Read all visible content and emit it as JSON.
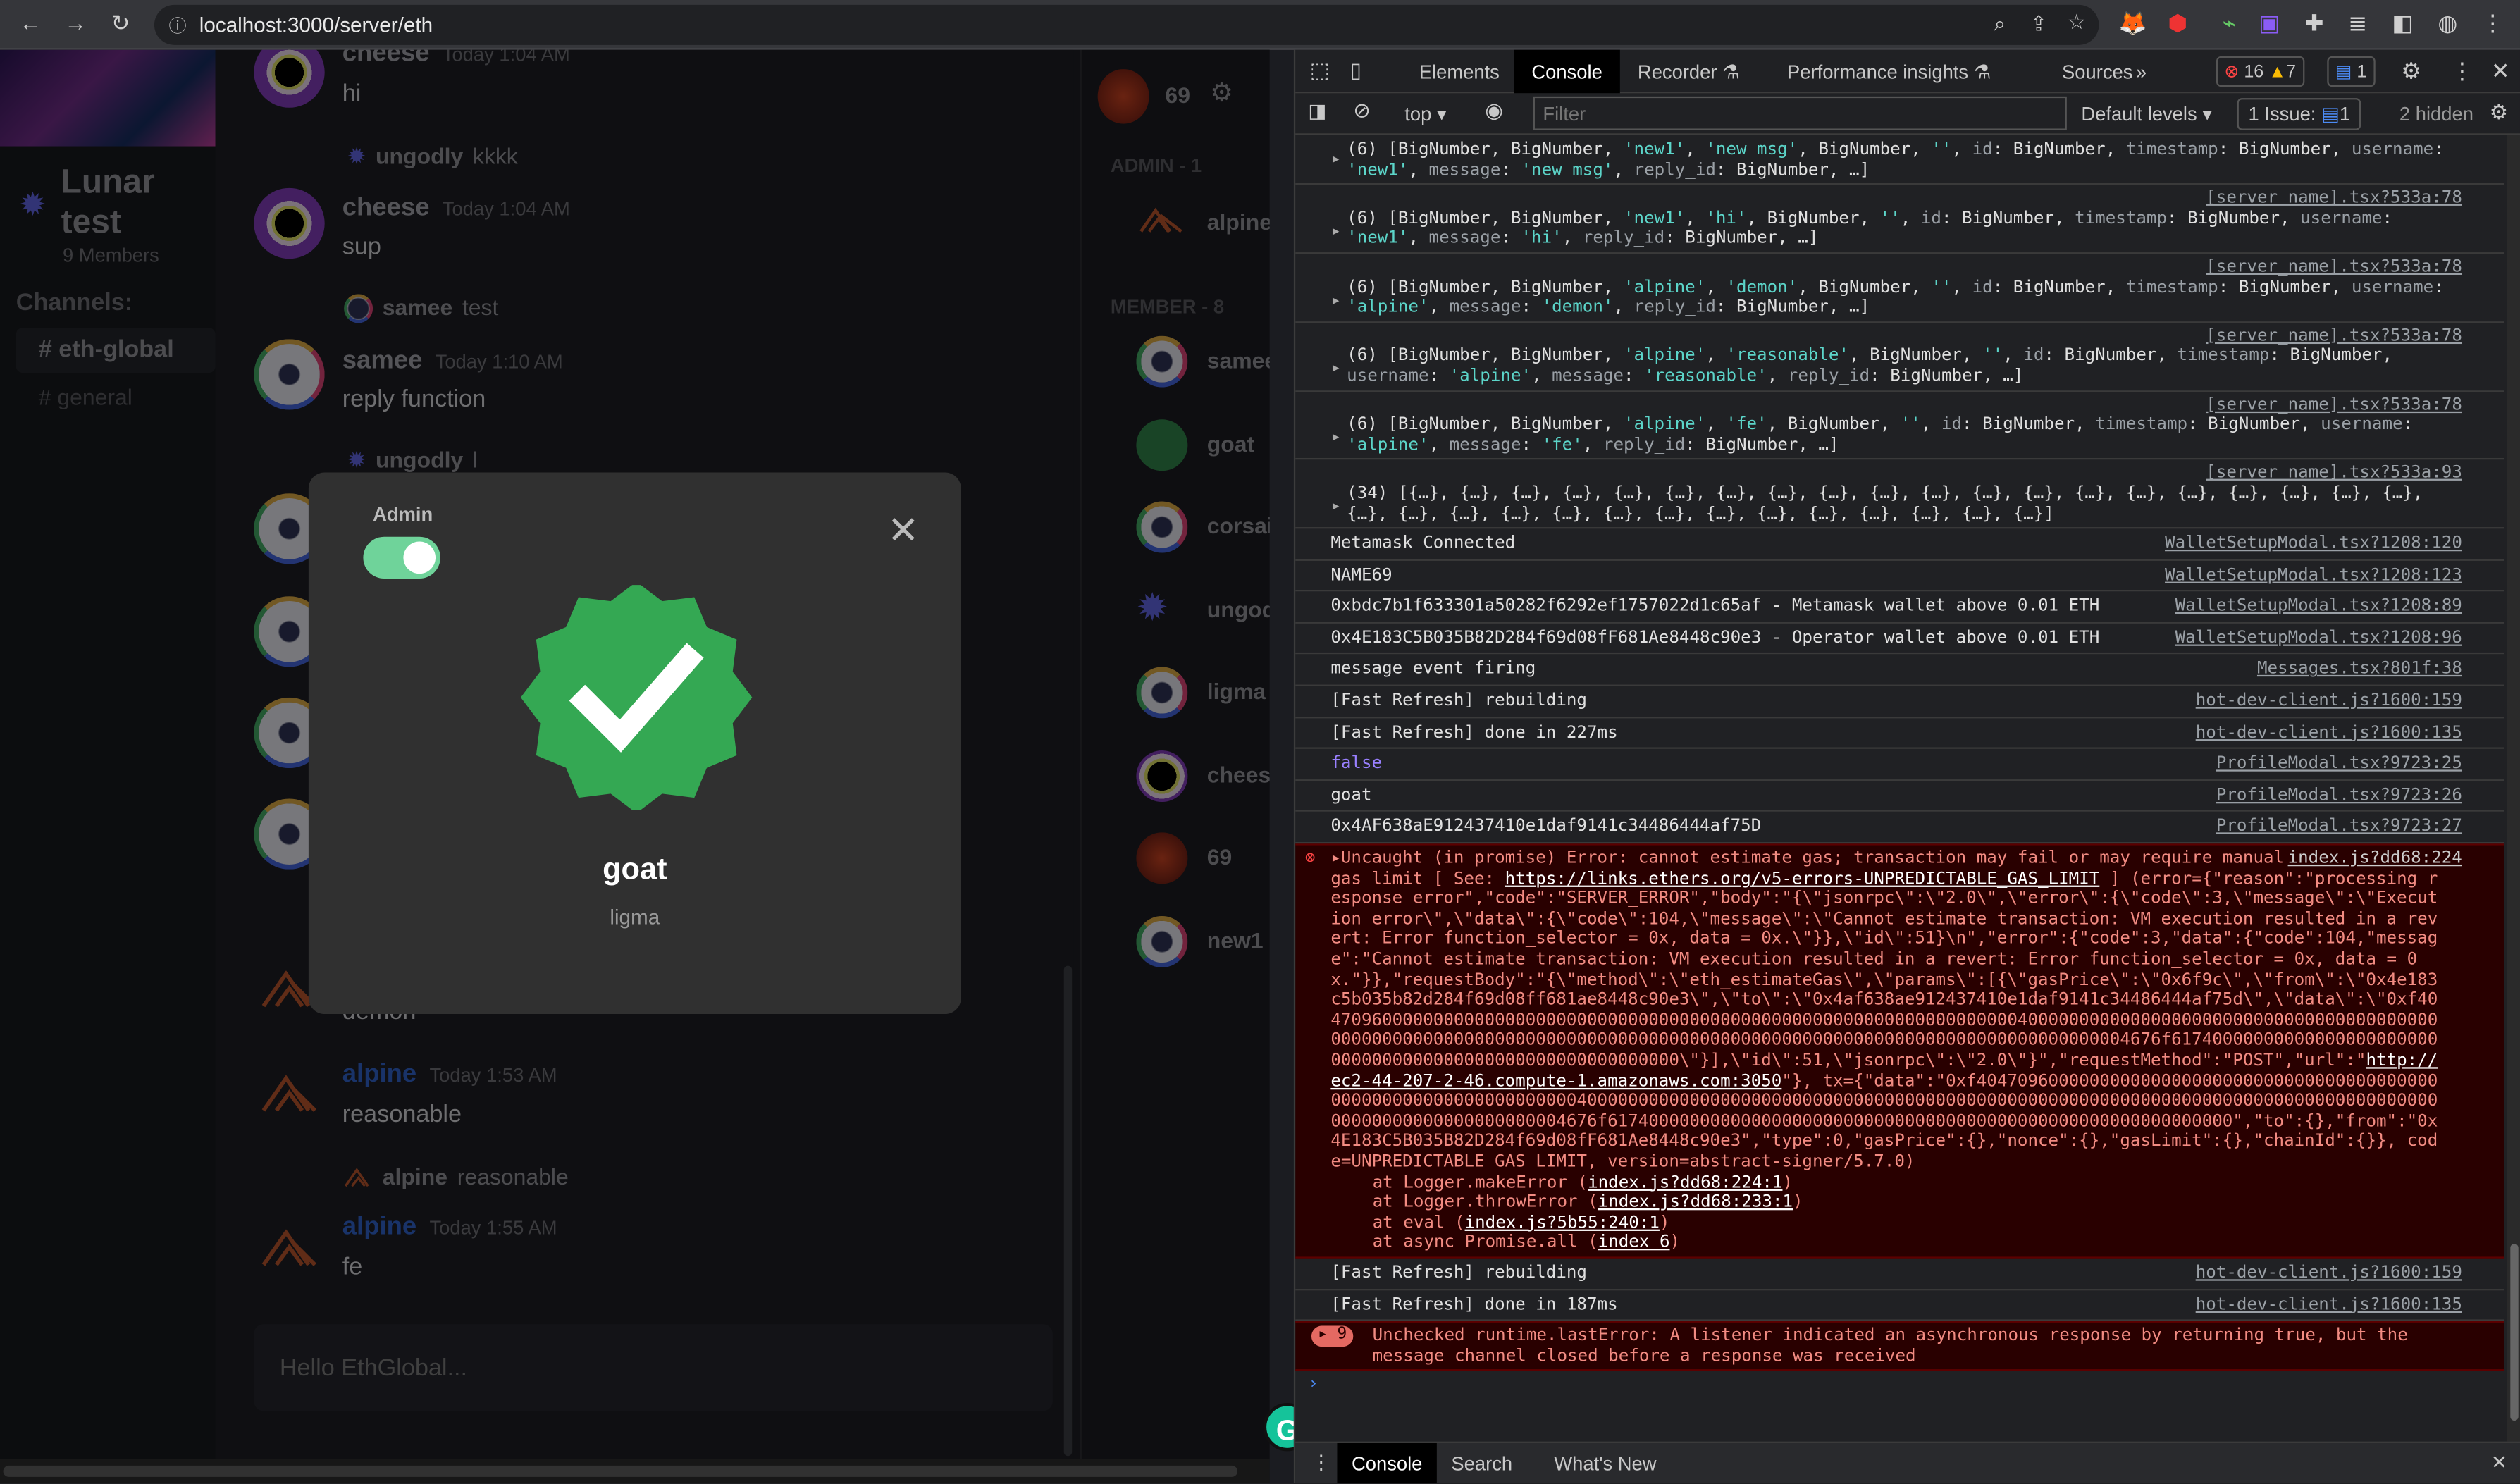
{
  "browser": {
    "url": "localhost:3000/server/eth"
  },
  "server": {
    "name": "Lunar test",
    "members": "9 Members",
    "channels_label": "Channels:",
    "channels": [
      "# eth-global",
      "# general"
    ],
    "active_channel": 0
  },
  "chat": {
    "messages": [
      {
        "user": "cheese",
        "time": "Today 1:04 AM",
        "text": "hi",
        "avatar": "cheese"
      },
      {
        "reply_user": "ungodly",
        "reply_text": "kkkk"
      },
      {
        "user": "cheese",
        "time": "Today 1:04 AM",
        "text": "sup",
        "avatar": "cheese"
      },
      {
        "reply_user": "samee",
        "reply_text": "test"
      },
      {
        "user": "samee",
        "time": "Today 1:10 AM",
        "text": "reply function",
        "avatar": "samee"
      },
      {
        "reply_user": "ungodly",
        "reply_text": "l"
      },
      {
        "text": "demon",
        "avatar": "alpine"
      },
      {
        "user": "alpine",
        "time": "Today 1:53 AM",
        "text": "reasonable",
        "avatar": "alpine"
      },
      {
        "reply_user": "alpine",
        "reply_text": "reasonable"
      },
      {
        "user": "alpine",
        "time": "Today 1:55 AM",
        "text": "fe",
        "avatar": "alpine"
      }
    ],
    "input_placeholder": "Hello EthGlobal..."
  },
  "members": {
    "current_user": "69",
    "admin_header": "ADMIN - 1",
    "admins": [
      "alpine"
    ],
    "member_header": "MEMBER - 8",
    "members": [
      "samee",
      "goat",
      "corsair",
      "ungodly",
      "ligma",
      "cheese",
      "69",
      "new1"
    ]
  },
  "modal": {
    "admin_label": "Admin",
    "admin_toggle_on": true,
    "name": "goat",
    "subtitle": "ligma",
    "badge_color": "#34a853"
  },
  "devtools": {
    "tabs": [
      "Elements",
      "Console",
      "Recorder",
      "Performance insights",
      "Sources"
    ],
    "active_tab": "Console",
    "errors": "16",
    "warnings": "7",
    "messages": "1",
    "context": "top",
    "filter_placeholder": "Filter",
    "levels": "Default levels",
    "issues": "1 Issue:",
    "issues_count": "1",
    "hidden": "2 hidden",
    "object_logs": [
      {
        "src": "",
        "text": "(6) [BigNumber, BigNumber, 'new1', 'new msg', BigNumber, '', id: BigNumber, timestamp: BigNumber, username: 'new1', message: 'new msg', reply_id: BigNumber, …]"
      },
      {
        "src": "[server_name].tsx?533a:78",
        "text": "(6) [BigNumber, BigNumber, 'new1', 'hi', BigNumber, '', id: BigNumber, timestamp: BigNumber, username: 'new1', message: 'hi', reply_id: BigNumber, …]"
      },
      {
        "src": "[server_name].tsx?533a:78",
        "text": "(6) [BigNumber, BigNumber, 'alpine', 'demon', BigNumber, '', id: BigNumber, timestamp: BigNumber, username: 'alpine', message: 'demon', reply_id: BigNumber, …]"
      },
      {
        "src": "[server_name].tsx?533a:78",
        "text": "(6) [BigNumber, BigNumber, 'alpine', 'reasonable', BigNumber, '', id: BigNumber, timestamp: BigNumber, username: 'alpine', message: 'reasonable', reply_id: BigNumber, …]"
      },
      {
        "src": "[server_name].tsx?533a:78",
        "text": "(6) [BigNumber, BigNumber, 'alpine', 'fe', BigNumber, '', id: BigNumber, timestamp: BigNumber, username: 'alpine', message: 'fe', reply_id: BigNumber, …]"
      },
      {
        "src": "[server_name].tsx?533a:93",
        "text": "(34) [{…}, {…}, {…}, {…}, {…}, {…}, {…}, {…}, {…}, {…}, {…}, {…}, {…}, {…}, {…}, {…}, {…}, {…}, {…}, {…}, {…}, {…}, {…}, {…}, {…}, {…}, {…}, {…}, {…}, {…}, {…}, {…}, {…}, {…}]"
      }
    ],
    "logs": [
      {
        "text": "Metamask Connected",
        "src": "WalletSetupModal.tsx?1208:120"
      },
      {
        "text": "NAME69",
        "src": "WalletSetupModal.tsx?1208:123"
      },
      {
        "text": "0xbdc7b1f633301a50282f6292ef1757022d1c65af - Metamask wallet above 0.01 ETH",
        "src": "WalletSetupModal.tsx?1208:89"
      },
      {
        "text": "0x4E183C5B035B82D284f69d08fF681Ae8448c90e3 - Operator wallet above 0.01 ETH",
        "src": "WalletSetupModal.tsx?1208:96"
      },
      {
        "text": "message event firing",
        "src": "Messages.tsx?801f:38"
      },
      {
        "text": "[Fast Refresh] rebuilding",
        "src": "hot-dev-client.js?1600:159"
      },
      {
        "text": "[Fast Refresh] done in 227ms",
        "src": "hot-dev-client.js?1600:135"
      },
      {
        "text": "false",
        "src": "ProfileModal.tsx?9723:25",
        "kind": "bool"
      },
      {
        "text": "goat",
        "src": "ProfileModal.tsx?9723:26"
      },
      {
        "text": "0x4AF638aE912437410e1daf9141c34486444af75D",
        "src": "ProfileModal.tsx?9723:27"
      }
    ],
    "error": {
      "src": "index.js?dd68:224",
      "head": "Uncaught (in promise) Error: cannot estimate gas; transaction may fail or may require manual gas limit [ See: ",
      "link": "https://links.ethers.org/v5-errors-UNPREDICTABLE_GAS_LIMIT",
      "body": " ] (error={\"reason\":\"processing response error\",\"code\":\"SERVER_ERROR\",\"body\":\"{\\\"jsonrpc\\\":\\\"2.0\\\",\\\"error\\\":{\\\"code\\\":3,\\\"message\\\":\\\"Execution error\\\",\\\"data\\\":{\\\"code\\\":104,\\\"message\\\":\\\"Cannot estimate transaction: VM execution resulted in a revert: Error function_selector = 0x, data = 0x.\\\"}},\\\"id\\\":51}\\n\",\"error\":{\"code\":3,\"data\":{\"code\":104,\"message\":\"Cannot estimate transaction: VM execution resulted in a revert: Error function_selector = 0x, data = 0x.\"}},\"requestBody\":\"{\\\"method\\\":\\\"eth_estimateGas\\\",\\\"params\\\":[{\\\"gasPrice\\\":\\\"0x6f9c\\\",\\\"from\\\":\\\"0x4e183c5b035b82d284f69d08ff681ae8448c90e3\\\",\\\"to\\\":\\\"0x4af638ae912437410e1daf9141c34486444af75d\\\",\\\"data\\\":\\\"0xf40470960000000000000000000000000000000000000000000000000000000000000040000000000000000000000000000000000000000000000000000000000000000000000000000000000000000000000000000000000000000000004676f617400000000000000000000000000000000000000000000000000000000\\\"}],\\\"id\\\":51,\\\"jsonrpc\\\":\\\"2.0\\\"}\",\"requestMethod\":\"POST\",\"url\":\"",
      "url": "http://ec2-44-207-2-46.compute-1.amazonaws.com:3050",
      "tail": "\"}, tx={\"data\":\"0xf40470960000000000000000000000000000000000000000000000000000000000000040000000000000000000000000000000000000000000000000000000000000000000000000000000000000000000000000000000004676f6174000000000000000000000000000000000000000000000000000000000\",\"to\":{},\"from\":\"0x4E183C5B035B82D284f69d08fF681Ae8448c90e3\",\"type\":0,\"gasPrice\":{},\"nonce\":{},\"gasLimit\":{},\"chainId\":{}}, code=UNPREDICTABLE_GAS_LIMIT, version=abstract-signer/5.7.0)",
      "stack": [
        [
          "at Logger.makeError (",
          "index.js?dd68:224:1",
          ")"
        ],
        [
          "at Logger.throwError (",
          "index.js?dd68:233:1",
          ")"
        ],
        [
          "at eval (",
          "index.js?5b55:240:1",
          ")"
        ],
        [
          "at async Promise.all (",
          "index 6",
          ")"
        ]
      ]
    },
    "logs_after": [
      {
        "text": "[Fast Refresh] rebuilding",
        "src": "hot-dev-client.js?1600:159"
      },
      {
        "text": "[Fast Refresh] done in 187ms",
        "src": "hot-dev-client.js?1600:135"
      }
    ],
    "runtime_error": {
      "count": "9",
      "text": "Unchecked runtime.lastError: A listener indicated an asynchronous response by returning true, but the message channel closed before a response was received"
    },
    "drawer_tabs": [
      "Console",
      "Search",
      "What's New"
    ]
  }
}
